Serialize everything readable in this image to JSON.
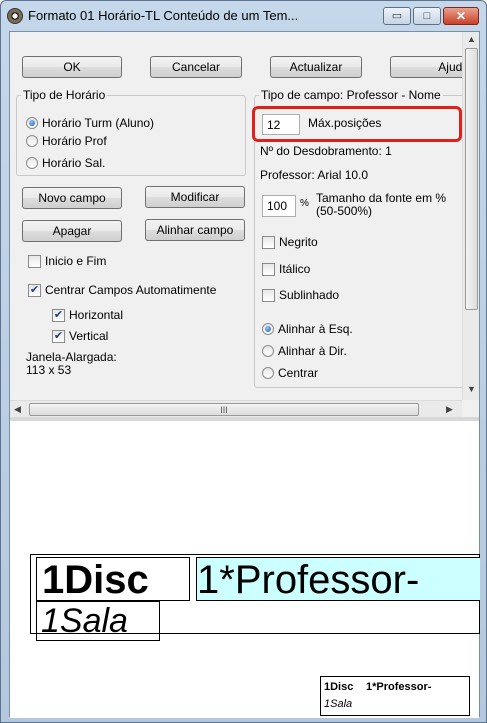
{
  "window": {
    "title": "Formato 01  Horário-TL  Conteúdo de um Tem...",
    "icon": "clock-app-icon",
    "controls": {
      "minimize_glyph": "▭",
      "maximize_glyph": "□",
      "close_glyph": "✕"
    }
  },
  "toolbar": {
    "ok": "OK",
    "cancel": "Cancelar",
    "update": "Actualizar",
    "help": "Ajuda"
  },
  "schedule_type": {
    "legend": "Tipo de Horário",
    "options": [
      "Horário Turm (Aluno)",
      "Horário Prof",
      "Horário Sal."
    ],
    "selected": "Horário Turm (Aluno)"
  },
  "field_buttons": {
    "new_field": "Novo campo",
    "modify": "Modificar",
    "delete": "Apagar",
    "align_field": "Alinhar campo"
  },
  "options": {
    "start_end": "Inicio e Fim",
    "start_end_checked": false,
    "center_auto": "Centrar Campos Automatimente",
    "center_auto_checked": true,
    "horizontal": "Horizontal",
    "horizontal_checked": true,
    "vertical": "Vertical",
    "vertical_checked": true
  },
  "enlarged_window": {
    "label": "Janela-Alargada:",
    "size": "113 x  53"
  },
  "field_type": {
    "legend": "Tipo de campo: Professor - Nome",
    "max_positions_value": "12",
    "max_positions_label": "Máx.posições",
    "unfold_number": "Nº do Desdobramento: 1",
    "font_info": "Professor: Arial 10.0",
    "font_size_value": "100",
    "font_size_unit": "%",
    "font_size_label": "Tamanho da fonte em %",
    "font_size_range": "(50-500%)",
    "bold": "Negrito",
    "bold_checked": false,
    "italic": "Itálico",
    "italic_checked": false,
    "underline": "Sublinhado",
    "underline_checked": false,
    "align_options": [
      "Alinhar à Esq.",
      "Alinhar à Dir.",
      "Centrar"
    ],
    "align_selected": "Alinhar à Esq."
  },
  "scrollbar": {
    "grip": "III",
    "left_arrow": "◀",
    "right_arrow": "▶",
    "up_arrow": "▲",
    "down_arrow": "▼"
  },
  "preview": {
    "disc": "1Disc",
    "professor": "1*Professor-",
    "room": "1Sala",
    "mini_disc": "1Disc",
    "mini_professor": "1*Professor-",
    "mini_room": "1Sala",
    "professor_highlight_color": "#ccffff"
  }
}
